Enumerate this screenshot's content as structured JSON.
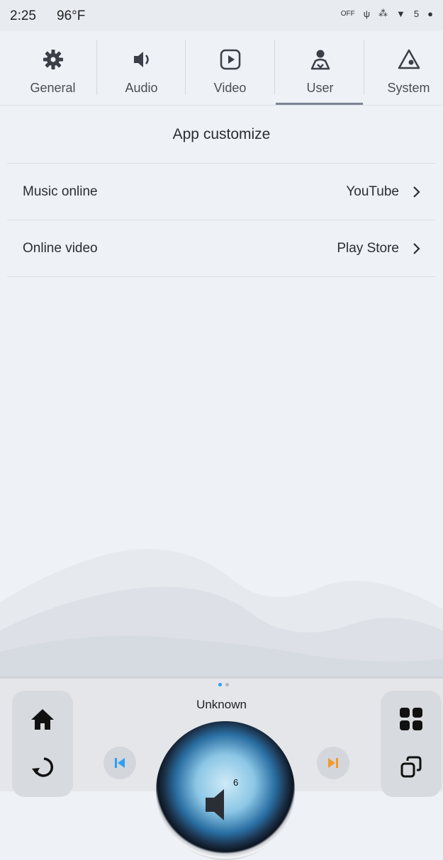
{
  "status": {
    "time": "2:25",
    "temp": "96°F",
    "off_label": "OFF",
    "signal_count": "5"
  },
  "tabs": [
    {
      "label": "General",
      "icon": "gear-icon"
    },
    {
      "label": "Audio",
      "icon": "speaker-icon"
    },
    {
      "label": "Video",
      "icon": "play-icon"
    },
    {
      "label": "User",
      "icon": "user-icon",
      "active": true
    },
    {
      "label": "System",
      "icon": "system-icon"
    }
  ],
  "section": {
    "title": "App customize"
  },
  "rows": [
    {
      "label": "Music online",
      "value": "YouTube"
    },
    {
      "label": "Online video",
      "value": "Play Store"
    }
  ],
  "dock": {
    "now_playing": "Unknown",
    "volume": "6",
    "page_dots": 2,
    "active_dot": 0,
    "colors": {
      "prev": "#2f9ef3",
      "next": "#f39a2a"
    }
  }
}
